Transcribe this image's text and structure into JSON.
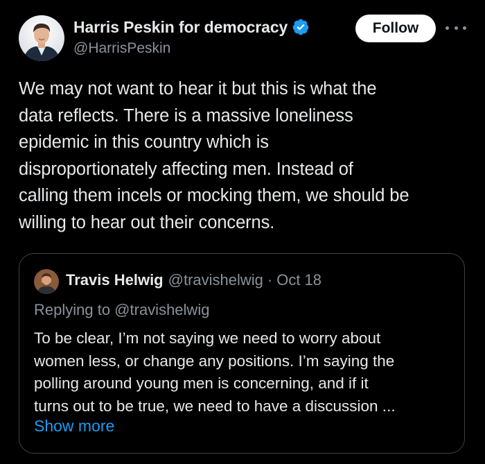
{
  "author": {
    "display_name": "Harris Peskin for democracy",
    "handle": "@HarrisPeskin",
    "verified": true,
    "avatar_icon": "profile-photo"
  },
  "actions": {
    "follow_label": "Follow",
    "more_icon": "more-horizontal-icon"
  },
  "tweet": {
    "lines": [
      "We may not want to hear it but this is what the",
      "data reflects. There is a massive loneliness",
      "epidemic in this country which is",
      "disproportionately affecting men. Instead of",
      "calling them incels or mocking them, we should be",
      "willing to hear out their concerns."
    ]
  },
  "quote": {
    "display_name": "Travis Helwig",
    "handle": "@travishelwig",
    "separator": "·",
    "date": "Oct 18",
    "replying_to": "Replying to @travishelwig",
    "lines": [
      "To be clear, I’m not saying we need to worry about",
      "women less, or change any positions. I’m saying the",
      "polling around young men is concerning, and if it",
      "turns out to be true, we need to have a discussion ..."
    ],
    "show_more": "Show more"
  },
  "colors": {
    "background": "#000000",
    "text_primary": "#e7e9ea",
    "text_secondary": "#8b9299",
    "accent_blue": "#1d9bf0",
    "border": "#3d4145"
  }
}
